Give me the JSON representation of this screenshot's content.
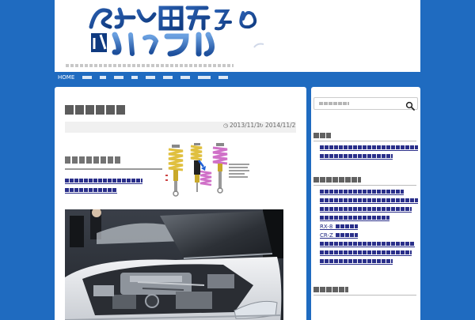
{
  "header": {
    "logo_line1": "",
    "logo_line2": "",
    "tagline": ""
  },
  "nav": {
    "items": [
      {
        "label": "HOME"
      },
      {
        "label": ""
      },
      {
        "label": ""
      },
      {
        "label": ""
      },
      {
        "label": ""
      },
      {
        "label": ""
      },
      {
        "label": ""
      },
      {
        "label": ""
      },
      {
        "label": ""
      },
      {
        "label": ""
      }
    ]
  },
  "post": {
    "title": "",
    "published_date": "2013/11/1",
    "modified_date": "2014/11/2",
    "related_heading": "",
    "related_links": [
      "",
      ""
    ]
  },
  "sidebar": {
    "search_placeholder": "",
    "widget1_title": "",
    "widget1_links": [
      "",
      ""
    ],
    "widget2_title": "",
    "widget2_links": [
      "",
      "",
      "",
      "",
      "RX-8",
      "CR-Z",
      "",
      "",
      ""
    ],
    "widget3_title": ""
  },
  "colors": {
    "page_background": "#1f6bc0",
    "link": "#1a237e",
    "logo_blue": "#1b4f9c"
  },
  "icons": {
    "published": "clock-icon",
    "modified": "refresh-icon",
    "search": "magnifier-icon"
  }
}
